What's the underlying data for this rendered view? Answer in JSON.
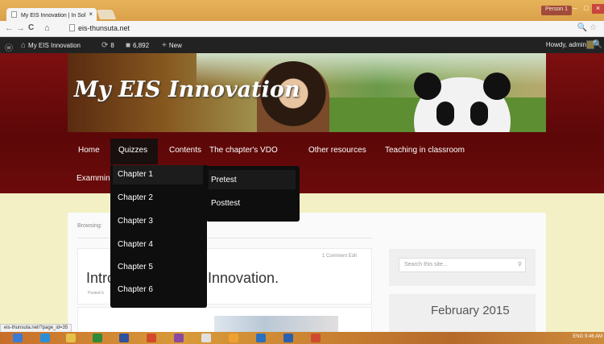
{
  "browser": {
    "tab_title": "My EIS Innovation | In Sol",
    "tab_close": "×",
    "profile": "Person 1",
    "back": "←",
    "forward": "→",
    "reload": "C",
    "home": "⌂",
    "url": "eis-thunsuta.net",
    "zoom_star": "🔍☆",
    "status_url": "eis-thunsuta.net/?page_id=35"
  },
  "adminbar": {
    "site_name": "My EIS Innovation",
    "updates": "8",
    "comments": "6,892",
    "new_label": "New",
    "howdy": "Howdy, admin"
  },
  "site": {
    "title": "My EIS Innovation"
  },
  "nav": {
    "items": [
      "Home",
      "Quizzes",
      "Contents",
      "The chapter's VDO",
      "Other resources",
      "Teaching in classroom"
    ],
    "row2": "Exammin"
  },
  "quizzes_menu": [
    "Chapter 1",
    "Chapter 2",
    "Chapter 3",
    "Chapter 4",
    "Chapter 5",
    "Chapter 6"
  ],
  "chapter1_submenu": [
    "Pretest",
    "Posttest"
  ],
  "content": {
    "breadcrumb": "Browsing:",
    "comment_meta": "1 Comment   Edit",
    "post_title_left": "Intro",
    "post_title_right": "Innovation.",
    "posted_by": "Posted b"
  },
  "sidebar": {
    "search_placeholder": "Search this site...",
    "calendar_title": "February 2015"
  },
  "taskbar": {
    "tray_time": "9:46 AM",
    "tray_lang": "ENG"
  }
}
